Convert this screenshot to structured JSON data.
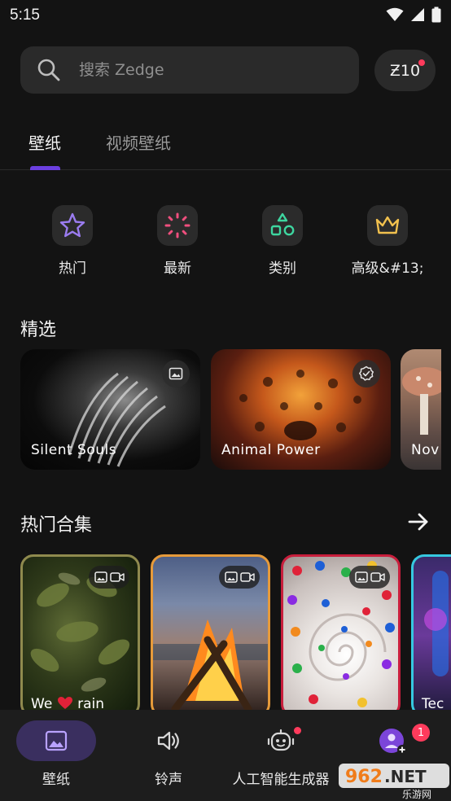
{
  "status_bar": {
    "time": "5:15"
  },
  "search": {
    "placeholder": "搜索 Zedge"
  },
  "credits": {
    "label": "Ƶ10"
  },
  "tabs": [
    {
      "label": "壁纸"
    },
    {
      "label": "视频壁纸"
    }
  ],
  "categories": [
    {
      "label": "热门",
      "icon": "star-icon",
      "color": "#9b7cf0"
    },
    {
      "label": "最新",
      "icon": "burst-icon",
      "color": "#f04f7e"
    },
    {
      "label": "类别",
      "icon": "shapes-icon",
      "color": "#3ed6a0"
    },
    {
      "label": "高级&#13;",
      "icon": "crown-icon",
      "color": "#f2c14e"
    }
  ],
  "featured": {
    "title": "精选",
    "items": [
      {
        "name": "Silent Souls",
        "badge": "image-icon"
      },
      {
        "name": "Animal Power",
        "badge": "verified-icon"
      },
      {
        "name": "Nov"
      }
    ]
  },
  "collections": {
    "title": "热门合集",
    "items": [
      {
        "name_pre": "We",
        "name_post": "rain",
        "border": "#8f8a4e"
      },
      {
        "name": "",
        "border": "#e69a3a"
      },
      {
        "name": "",
        "border": "#c81e3c"
      },
      {
        "name": "Tec",
        "border": "#36c8e0"
      }
    ]
  },
  "bottom_nav": [
    {
      "label": "壁纸",
      "icon": "wallpaper-icon",
      "active": true
    },
    {
      "label": "铃声",
      "icon": "speaker-icon"
    },
    {
      "label": "人工智能生成器",
      "icon": "robot-icon"
    },
    {
      "label": "",
      "icon": "profile-icon",
      "count": "1"
    }
  ],
  "watermark": {
    "text": "962",
    "suffix": ".NET",
    "sub": "乐游网"
  }
}
